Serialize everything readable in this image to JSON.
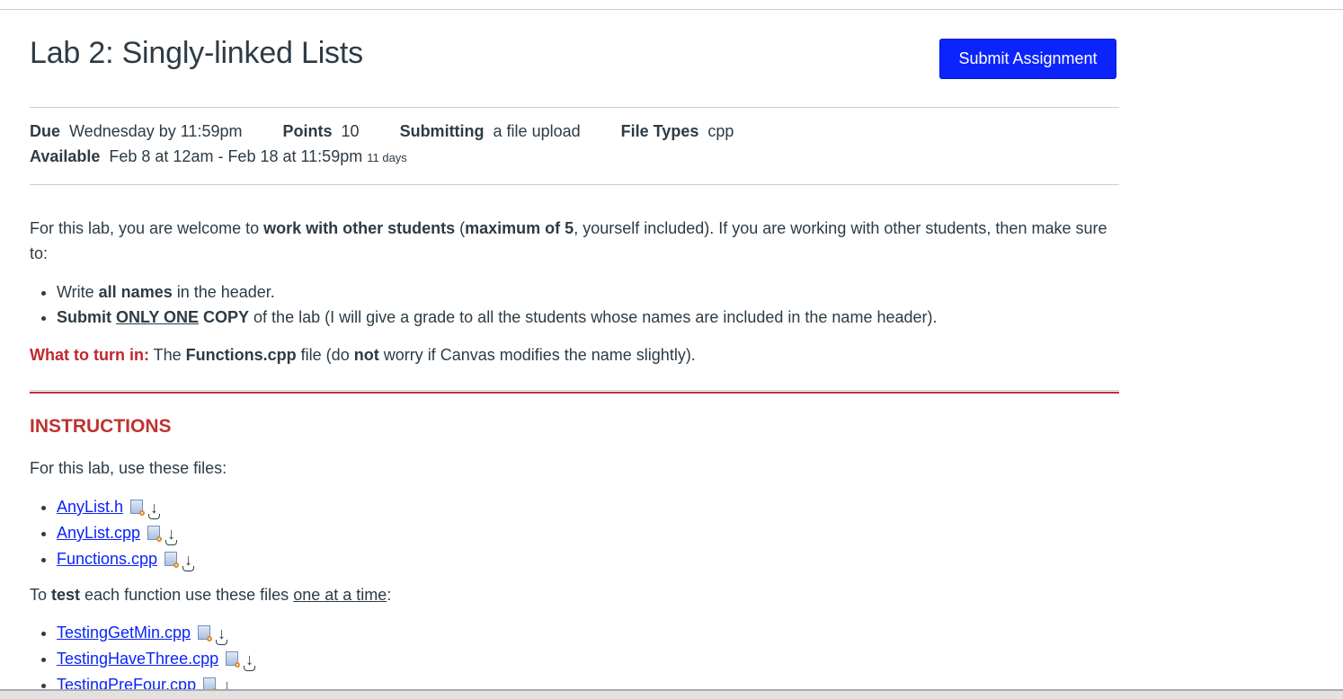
{
  "assignment": {
    "title": "Lab 2: Singly-linked Lists",
    "submit_label": "Submit Assignment"
  },
  "details": {
    "due_label": "Due",
    "due_value": "Wednesday by 11:59pm",
    "points_label": "Points",
    "points_value": "10",
    "submitting_label": "Submitting",
    "submitting_value": "a file upload",
    "file_types_label": "File Types",
    "file_types_value": "cpp",
    "available_label": "Available",
    "available_value": "Feb 8 at 12am - Feb 18 at 11:59pm",
    "available_duration": "11 days"
  },
  "intro": {
    "t1": "For this lab, you are welcome to ",
    "b1": "work with other students",
    "t2": " (",
    "b2": "maximum of 5",
    "t3": ", yourself included). If you are working with other students, then make sure to:"
  },
  "rules": [
    {
      "t1": "Write ",
      "b1": "all names",
      "t2": " in the header."
    },
    {
      "b1": "Submit ",
      "u1": "ONLY ONE",
      "b2": " COPY",
      "t2": " of the lab (I will give a grade to all the students whose names are included in the name header)."
    }
  ],
  "turn_in": {
    "label": "What to turn in:",
    "t1": " The ",
    "b1": "Functions.cpp",
    "t2": " file (do ",
    "b2": "not",
    "t3": " worry if Canvas modifies the name slightly)."
  },
  "instructions": {
    "heading": "INSTRUCTIONS",
    "use_files_text": "For this lab, use these files:",
    "files": [
      "AnyList.h",
      "AnyList.cpp",
      "Functions.cpp"
    ],
    "test_t1": "To ",
    "test_b1": "test",
    "test_t2": " each function use these files ",
    "test_u1": "one at a time",
    "test_t3": ":",
    "test_files": [
      "TestingGetMin.cpp",
      "TestingHaveThree.cpp",
      "TestingPreFour.cpp"
    ]
  },
  "icons": {
    "preview": "document-preview-icon",
    "download": "download-icon",
    "download_glyph": "↓"
  },
  "colors": {
    "primary_button": "#0a24fb",
    "link": "#0a24fb",
    "heading_red": "#bf3330",
    "text": "#2d3b45"
  }
}
